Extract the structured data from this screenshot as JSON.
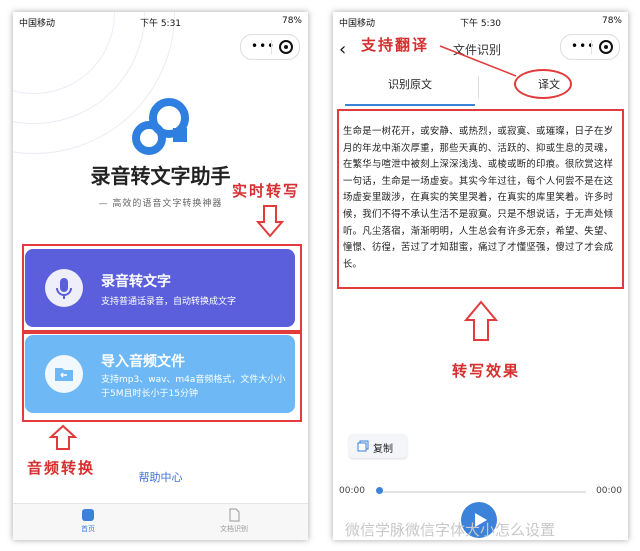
{
  "left_screen": {
    "status": {
      "carrier": "中国移动",
      "time": "下午 5:31",
      "battery": "78%"
    },
    "app_title": "录音转文字助手",
    "app_subtitle": "— 高效的语音文字转换神器",
    "record_card": {
      "title": "录音转文字",
      "desc": "支持普通话录音，自动转换成文字"
    },
    "import_card": {
      "title": "导入音频文件",
      "desc": "支持mp3、wav、m4a音频格式，文件大小小于5M且时长小于15分钟"
    },
    "help_link": "帮助中心",
    "tabs": [
      {
        "label": "首页"
      },
      {
        "label": "文档识别"
      }
    ]
  },
  "right_screen": {
    "status": {
      "carrier": "中国移动",
      "time": "下午 5:30",
      "battery": "78%"
    },
    "nav_title": "文件识别",
    "tabs": [
      {
        "label": "识别原文"
      },
      {
        "label": "译文"
      }
    ],
    "transcript": "生命是一树花开，或安静、或热烈，或寂寞、或璀璨，日子在岁月的年龙中渐次厚重，那些天真的、活跃的、抑或生息的灵魂，在繁华与喧泄中被刻上深深浅浅、或棱或断的印痕。很欣赏这样一句话，生命是一场虚妄。其实今年过往，每个人何尝不是在这场虚妄里跋涉，在真实的笑里哭着，在真实的库里笑着。许多时候，我们不得不承认生活不是寂寞。只是不想说话，于无声处倾听。凡尘落宿，渐渐明明，人生总会有许多无奈，希望、失望、憧憬、彷徨，苦过了才知甜蜜，痛过了才懂坚强，傻过了才会成长。",
    "copy_label": "复制",
    "time_start": "00:00",
    "time_end": "00:00",
    "progress": 0
  },
  "annotations": {
    "realtime": "实时转写",
    "audio_convert": "音频转换",
    "translate": "支持翻译",
    "effect": "转写效果"
  },
  "watermark": "微信学脉微信字体大小怎么设置",
  "colors": {
    "record_card": "#5b5fdc",
    "import_card": "#6db8f5",
    "accent": "#3b82d8",
    "annotation": "#e23b3b"
  }
}
